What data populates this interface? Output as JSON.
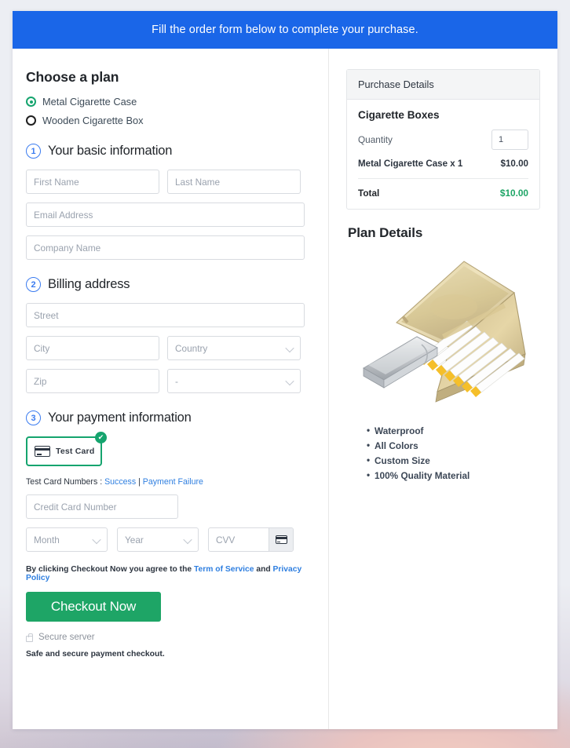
{
  "banner": {
    "text": "Fill the order form below to complete your purchase."
  },
  "plan": {
    "heading": "Choose a plan",
    "options": [
      {
        "label": "Metal Cigarette Case",
        "selected": true
      },
      {
        "label": "Wooden Cigarette Box",
        "selected": false
      }
    ]
  },
  "steps": {
    "basic": {
      "num": "1",
      "title": "Your basic information"
    },
    "billing": {
      "num": "2",
      "title": "Billing address"
    },
    "payment": {
      "num": "3",
      "title": "Your payment information"
    }
  },
  "fields": {
    "first_name": "First Name",
    "last_name": "Last Name",
    "email": "Email Address",
    "company": "Company Name",
    "street": "Street",
    "city": "City",
    "country": "Country",
    "zip": "Zip",
    "state": "-",
    "credit_card": "Credit Card Number",
    "month": "Month",
    "year": "Year",
    "cvv": "CVV"
  },
  "payment": {
    "tile_label": "Test  Card",
    "tile_selected": true,
    "check_glyph": "✔",
    "test_numbers_prefix": "Test Card Numbers : ",
    "link_success": "Success",
    "separator": " | ",
    "link_failure": "Payment Failure"
  },
  "terms": {
    "prefix": "By clicking Checkout Now you agree to the ",
    "link_tos": "Term of Service",
    "middle": " and ",
    "link_privacy": "Privacy Policy"
  },
  "checkout": {
    "button_label": "Checkout Now",
    "secure_label": "Secure server",
    "safe_label": "Safe and secure payment checkout."
  },
  "purchase": {
    "panel_header": "Purchase Details",
    "product_title": "Cigarette Boxes",
    "quantity_label": "Quantity",
    "quantity_value": "1",
    "line_label": "Metal Cigarette Case x 1",
    "line_price": "$10.00",
    "total_label": "Total",
    "total_price": "$10.00"
  },
  "plan_details": {
    "heading": "Plan Details",
    "image_name": "metal-cigarette-case-photo",
    "features": [
      "Waterproof",
      "All Colors",
      "Custom Size",
      "100% Quality Material"
    ]
  },
  "colors": {
    "banner_blue": "#1a66e8",
    "accent_green": "#1ea566",
    "select_green": "#15a46e",
    "link_blue": "#2f7fe0",
    "step_blue": "#3a7bf0"
  }
}
